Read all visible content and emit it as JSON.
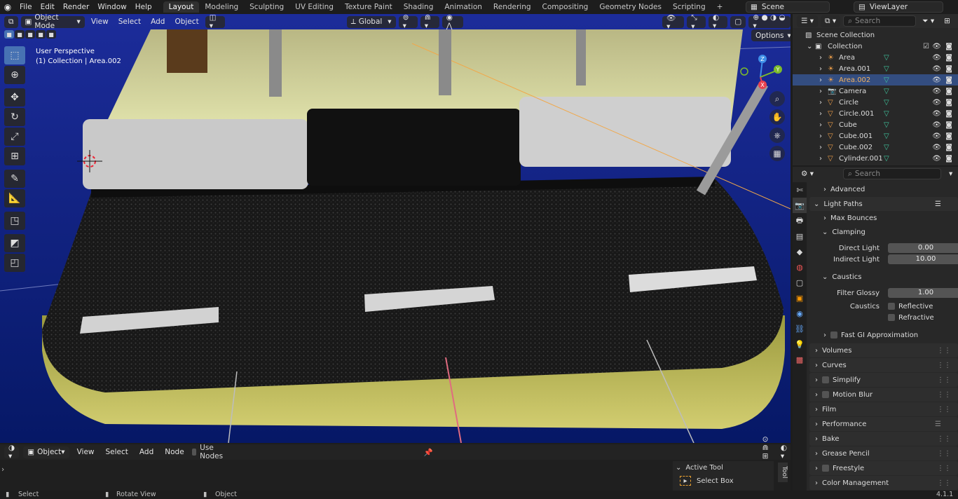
{
  "topbar": {
    "menus": [
      "File",
      "Edit",
      "Render",
      "Window",
      "Help"
    ],
    "workspaces": [
      "Layout",
      "Modeling",
      "Sculpting",
      "UV Editing",
      "Texture Paint",
      "Shading",
      "Animation",
      "Rendering",
      "Compositing",
      "Geometry Nodes",
      "Scripting"
    ],
    "active_workspace": "Layout",
    "add_tab": "+",
    "scene": "Scene",
    "view_layer": "ViewLayer"
  },
  "viewport": {
    "mode": "Object Mode",
    "menus": [
      "View",
      "Select",
      "Add",
      "Object"
    ],
    "orientation": "Global",
    "options": "Options",
    "overlay_title": "User Perspective",
    "overlay_subtitle": "(1) Collection | Area.002",
    "gizmo": {
      "x": "X",
      "y": "Y",
      "z": "Z"
    }
  },
  "outliner": {
    "search_placeholder": "Search",
    "root": "Scene Collection",
    "collection": "Collection",
    "items": [
      {
        "name": "Area",
        "type": "light",
        "selected": false
      },
      {
        "name": "Area.001",
        "type": "light",
        "selected": false
      },
      {
        "name": "Area.002",
        "type": "light",
        "selected": true
      },
      {
        "name": "Camera",
        "type": "camera",
        "selected": false
      },
      {
        "name": "Circle",
        "type": "mesh",
        "selected": false
      },
      {
        "name": "Circle.001",
        "type": "mesh",
        "selected": false
      },
      {
        "name": "Cube",
        "type": "mesh",
        "selected": false
      },
      {
        "name": "Cube.001",
        "type": "mesh",
        "selected": false
      },
      {
        "name": "Cube.002",
        "type": "mesh",
        "selected": false
      },
      {
        "name": "Cylinder.001",
        "type": "mesh",
        "selected": false
      }
    ]
  },
  "properties": {
    "search_placeholder": "Search",
    "advanced": "Advanced",
    "light_paths": "Light Paths",
    "max_bounces": "Max Bounces",
    "clamping": "Clamping",
    "direct_light_label": "Direct Light",
    "direct_light_value": "0.00",
    "indirect_light_label": "Indirect Light",
    "indirect_light_value": "10.00",
    "caustics": "Caustics",
    "filter_glossy_label": "Filter Glossy",
    "filter_glossy_value": "1.00",
    "caustics_label": "Caustics",
    "reflective": "Reflective",
    "refractive": "Refractive",
    "fast_gi": "Fast GI Approximation",
    "panels": [
      "Volumes",
      "Curves",
      "Simplify",
      "Motion Blur",
      "Film",
      "Performance",
      "Bake",
      "Grease Pencil",
      "Freestyle",
      "Color Management"
    ]
  },
  "node_editor": {
    "type": "Object",
    "menus": [
      "View",
      "Select",
      "Add",
      "Node"
    ],
    "use_nodes": "Use Nodes",
    "active_tool_header": "Active Tool",
    "active_tool": "Select Box",
    "side_tab": "Tool"
  },
  "status": {
    "select": "Select",
    "rotate": "Rotate View",
    "object": "Object",
    "version": "4.1.1"
  },
  "colors": {
    "accent": "#4772b3",
    "selected_row": "#334d80",
    "axis_x": "#e8424f",
    "axis_y": "#7dbb2b",
    "axis_z": "#3d8ee8"
  }
}
